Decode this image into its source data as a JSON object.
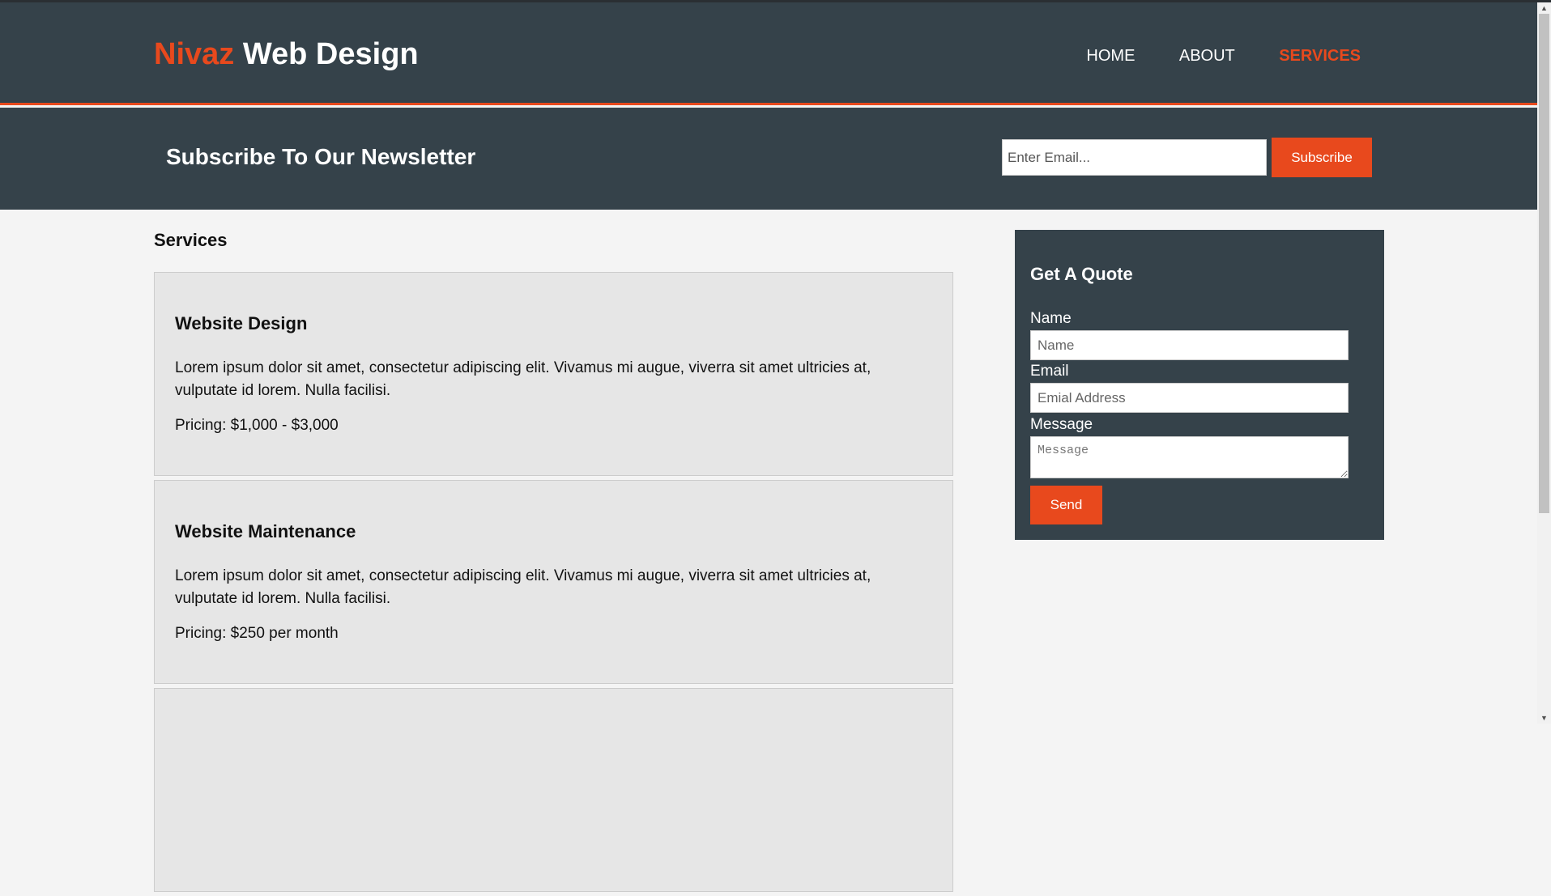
{
  "header": {
    "brand_highlight": "Nivaz",
    "brand_rest": " Web Design",
    "nav": [
      {
        "label": "HOME",
        "current": false
      },
      {
        "label": "ABOUT",
        "current": false
      },
      {
        "label": "SERVICES",
        "current": true
      }
    ]
  },
  "newsletter": {
    "title": "Subscribe To Our Newsletter",
    "email_placeholder": "Enter Email...",
    "subscribe_label": "Subscribe"
  },
  "main": {
    "title": "Services",
    "services": [
      {
        "title": "Website Design",
        "description": "Lorem ipsum dolor sit amet, consectetur adipiscing elit. Vivamus mi augue, viverra sit amet ultricies at, vulputate id lorem. Nulla facilisi.",
        "pricing": "Pricing: $1,000 - $3,000"
      },
      {
        "title": "Website Maintenance",
        "description": "Lorem ipsum dolor sit amet, consectetur adipiscing elit. Vivamus mi augue, viverra sit amet ultricies at, vulputate id lorem. Nulla facilisi.",
        "pricing": "Pricing: $250 per month"
      },
      {
        "title": "",
        "description": "",
        "pricing": ""
      }
    ]
  },
  "quote": {
    "title": "Get A Quote",
    "name_label": "Name",
    "name_placeholder": "Name",
    "email_label": "Email",
    "email_placeholder": "Emial Address",
    "message_label": "Message",
    "message_placeholder": "Message",
    "send_label": "Send"
  },
  "colors": {
    "accent": "#e8491d",
    "dark": "#35424a",
    "background": "#f4f4f4",
    "card": "#e6e6e6"
  },
  "icons": {
    "scroll_up": "scroll-up-arrow-icon",
    "scroll_down": "scroll-down-arrow-icon"
  }
}
